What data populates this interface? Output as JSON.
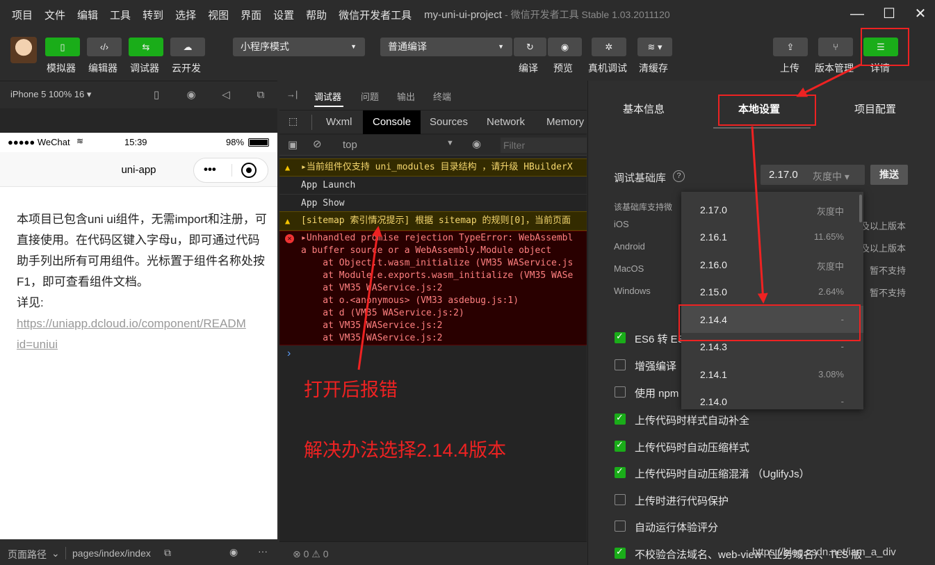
{
  "menubar": {
    "items": [
      "项目",
      "文件",
      "编辑",
      "工具",
      "转到",
      "选择",
      "视图",
      "界面",
      "设置",
      "帮助",
      "微信开发者工具"
    ],
    "project": "my-uni-ui-project",
    "app_version": "- 微信开发者工具 Stable 1.03.2011120"
  },
  "toolbar": {
    "simulator": "模拟器",
    "editor": "编辑器",
    "debugger": "调试器",
    "cloud": "云开发",
    "mode_select": "小程序模式",
    "compile_select": "普通编译",
    "compile": "编译",
    "preview": "预览",
    "real_debug": "真机调试",
    "clear_cache": "清缓存",
    "upload": "上传",
    "version_mgmt": "版本管理",
    "details": "详情"
  },
  "simulator": {
    "device": "iPhone 5 100% 16 ▾",
    "status_left": "●●●●● WeChat",
    "status_time": "15:39",
    "status_battery": "98%",
    "nav_title": "uni-app",
    "content_text": "本项目已包含uni ui组件，无需import和注册，可直接使用。在代码区键入字母u，即可通过代码助手列出所有可用组件。光标置于组件名称处按F1，即可查看组件文档。",
    "detail_label": "详见:",
    "link_line1": "https://uniapp.dcloud.io/component/READM",
    "link_line2": "id=uniui",
    "footer_path_label": "页面路径",
    "footer_path": "pages/index/index"
  },
  "console": {
    "tabs_top": [
      "调试器",
      "问题",
      "输出",
      "终端"
    ],
    "tabs": [
      "Wxml",
      "Console",
      "Sources",
      "Network",
      "Memory"
    ],
    "context": "top",
    "filter_placeholder": "Filter",
    "warn1": "▸当前组件仅支持 uni_modules 目录结构 ，请升级 HBuilderX",
    "info1": "App Launch",
    "info2": "App Show",
    "warn2": "[sitemap 索引情况提示] 根据 sitemap 的规则[0]，当前页面",
    "err_lines": [
      "▸Unhandled promise rejection TypeError: WebAssembl",
      "a buffer source or a WebAssembly.Module object",
      "    at Object.t.wasm_initialize (VM35 WAService.js",
      "    at Module.e.exports.wasm_initialize (VM35 WASe",
      "    at VM35 WAService.js:2",
      "    at o.<anonymous> (VM33 asdebug.js:1)",
      "    at d (VM35 WAService.js:2)",
      "    at VM35 WAService.js:2",
      "    at VM35 WAService.js:2"
    ],
    "prompt": "›",
    "annotation1": "打开后报错",
    "annotation2": "解决办法选择2.14.4版本",
    "footer_counts": "⊗ 0 ⚠ 0"
  },
  "details": {
    "tabs": [
      "基本信息",
      "本地设置",
      "项目配置"
    ],
    "base_lib_label": "调试基础库",
    "base_lib_value": "2.17.0",
    "base_lib_status": "灰度中 ▾",
    "push_button": "推送",
    "support_note": "该基础库支持微",
    "platforms": [
      "iOS",
      "Android",
      "MacOS",
      "Windows"
    ],
    "platform_values": [
      "及以上版本",
      "及以上版本",
      "暂不支持",
      "暂不支持"
    ],
    "checkboxes": [
      {
        "label": "ES6 转 ES5",
        "checked": true
      },
      {
        "label": "增强编译",
        "checked": false
      },
      {
        "label": "使用 npm 模块",
        "checked": false
      },
      {
        "label": "上传代码时样式自动补全",
        "checked": true
      },
      {
        "label": "上传代码时自动压缩样式",
        "checked": true
      },
      {
        "label": "上传代码时自动压缩混淆 （UglifyJs）",
        "checked": true
      },
      {
        "label": "上传时进行代码保护",
        "checked": false
      },
      {
        "label": "自动运行体验评分",
        "checked": false
      },
      {
        "label": "不校验合法域名、web-view（业务域名）、TLS 版",
        "checked": true
      }
    ],
    "versions": [
      {
        "v": "2.17.0",
        "p": "灰度中"
      },
      {
        "v": "2.16.1",
        "p": "11.65%"
      },
      {
        "v": "2.16.0",
        "p": "灰度中"
      },
      {
        "v": "2.15.0",
        "p": "2.64%"
      },
      {
        "v": "2.14.4",
        "p": "-"
      },
      {
        "v": "2.14.3",
        "p": "-"
      },
      {
        "v": "2.14.1",
        "p": "3.08%"
      },
      {
        "v": "2.14.0",
        "p": "-"
      }
    ],
    "watermark": "https://blog.csdn.net/iam_a_div"
  },
  "colors": {
    "accent": "#1aad19",
    "annotation": "#e22222",
    "error_bg": "#290000",
    "warn_bg": "#332b00"
  }
}
